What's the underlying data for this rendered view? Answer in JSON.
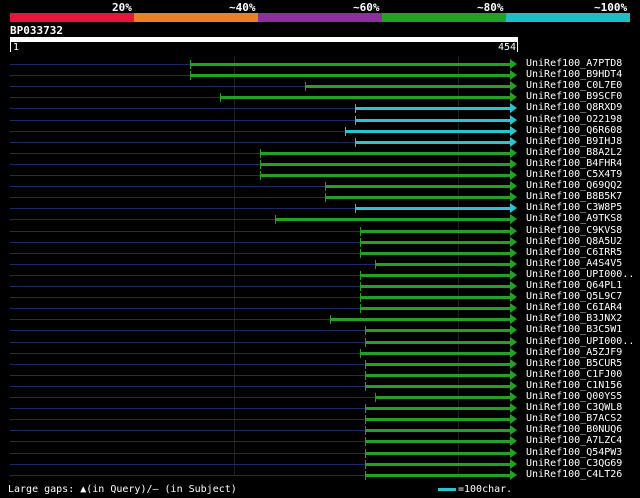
{
  "legend": {
    "labels": [
      "20%",
      "~40%",
      "~60%",
      "~80%",
      "~100%"
    ],
    "colors": [
      "#e8143a",
      "#ee7f22",
      "#8e2fa0",
      "#22a122",
      "#1dbec8"
    ]
  },
  "query": {
    "name": "BP033732",
    "start": "1",
    "end": "454",
    "length": 454
  },
  "footer": {
    "gaps_text": "Large gaps: ▲(in Query)/– (in Subject)",
    "scale_text": "=100char."
  },
  "hits": [
    {
      "name": "UniRef100_A7PTD8",
      "start": 0.36,
      "color": "green"
    },
    {
      "name": "UniRef100_B9HDT4",
      "start": 0.36,
      "color": "green"
    },
    {
      "name": "UniRef100_C0L7E0",
      "start": 0.59,
      "color": "green"
    },
    {
      "name": "UniRef100_B9SCF0",
      "start": 0.42,
      "color": "green"
    },
    {
      "name": "UniRef100_Q8RXD9",
      "start": 0.69,
      "color": "cyan"
    },
    {
      "name": "UniRef100_O22198",
      "start": 0.69,
      "color": "cyan"
    },
    {
      "name": "UniRef100_Q6R608",
      "start": 0.67,
      "color": "cyan"
    },
    {
      "name": "UniRef100_B9IHJ8",
      "start": 0.69,
      "color": "cyan"
    },
    {
      "name": "UniRef100_B8A2L2",
      "start": 0.5,
      "color": "green"
    },
    {
      "name": "UniRef100_B4FHR4",
      "start": 0.5,
      "color": "green"
    },
    {
      "name": "UniRef100_C5X4T9",
      "start": 0.5,
      "color": "green"
    },
    {
      "name": "UniRef100_Q69QQ2",
      "start": 0.63,
      "color": "green"
    },
    {
      "name": "UniRef100_B8B5K7",
      "start": 0.63,
      "color": "green"
    },
    {
      "name": "UniRef100_C3W8P5",
      "start": 0.69,
      "color": "cyan"
    },
    {
      "name": "UniRef100_A9TKS8",
      "start": 0.53,
      "color": "green"
    },
    {
      "name": "UniRef100_C9KVS8",
      "start": 0.7,
      "color": "green"
    },
    {
      "name": "UniRef100_Q8A5U2",
      "start": 0.7,
      "color": "green"
    },
    {
      "name": "UniRef100_C6IRR5",
      "start": 0.7,
      "color": "green"
    },
    {
      "name": "UniRef100_A4S4V5",
      "start": 0.73,
      "color": "green"
    },
    {
      "name": "UniRef100_UPI000..",
      "start": 0.7,
      "color": "green"
    },
    {
      "name": "UniRef100_Q64PL1",
      "start": 0.7,
      "color": "green"
    },
    {
      "name": "UniRef100_Q5L9C7",
      "start": 0.7,
      "color": "green"
    },
    {
      "name": "UniRef100_C6IAR4",
      "start": 0.7,
      "color": "green"
    },
    {
      "name": "UniRef100_B3JNX2",
      "start": 0.64,
      "color": "green"
    },
    {
      "name": "UniRef100_B3C5W1",
      "start": 0.71,
      "color": "green"
    },
    {
      "name": "UniRef100_UPI000..",
      "start": 0.71,
      "color": "green"
    },
    {
      "name": "UniRef100_A5ZJF9",
      "start": 0.7,
      "color": "green"
    },
    {
      "name": "UniRef100_B5CUR5",
      "start": 0.71,
      "color": "green"
    },
    {
      "name": "UniRef100_C1FJ00",
      "start": 0.71,
      "color": "green"
    },
    {
      "name": "UniRef100_C1N156",
      "start": 0.71,
      "color": "green"
    },
    {
      "name": "UniRef100_Q00YS5",
      "start": 0.73,
      "color": "green"
    },
    {
      "name": "UniRef100_C3QWL8",
      "start": 0.71,
      "color": "green"
    },
    {
      "name": "UniRef100_B7ACS2",
      "start": 0.71,
      "color": "green"
    },
    {
      "name": "UniRef100_B0NUQ6",
      "start": 0.71,
      "color": "green"
    },
    {
      "name": "UniRef100_A7LZC4",
      "start": 0.71,
      "color": "green"
    },
    {
      "name": "UniRef100_Q54PW3",
      "start": 0.71,
      "color": "green"
    },
    {
      "name": "UniRef100_C3QG69",
      "start": 0.71,
      "color": "green"
    },
    {
      "name": "UniRef100_C4LT26",
      "start": 0.71,
      "color": "green"
    }
  ],
  "colors": {
    "green": "#22a122",
    "cyan": "#29c4cf",
    "miss": "#1c2a66"
  }
}
